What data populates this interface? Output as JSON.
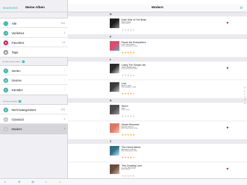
{
  "status": {
    "carrier": "Carrier ᯤ",
    "time": "12:00 PM",
    "battery": "100%"
  },
  "sidebar": {
    "edit_label": "Bearbeiten",
    "title": "Meine Alben",
    "library": [
      {
        "label": "Alle",
        "count": "540",
        "icon": "music-icon",
        "color": "#3fb9b0",
        "glyph": "♪"
      },
      {
        "label": "Verliehen",
        "count": "3",
        "icon": "lend-icon",
        "color": "#3fb9b0",
        "glyph": "↗"
      },
      {
        "label": "Favoriten",
        "count": "15",
        "icon": "heart-icon",
        "color": "#e0245e",
        "glyph": "♥"
      },
      {
        "label": "Tags",
        "count": "",
        "icon": "tag-icon",
        "color": "#9a9aa0",
        "glyph": "◆"
      }
    ],
    "browse_header": "DURCHSUCHEN",
    "browse": [
      {
        "label": "Serien",
        "count": "›",
        "icon": "series-icon",
        "color": "#3fb9b0",
        "glyph": "≡"
      },
      {
        "label": "Genres",
        "count": "›",
        "icon": "genre-icon",
        "color": "#3fb9b0",
        "glyph": "◎"
      },
      {
        "label": "Künstler",
        "count": "›",
        "icon": "artist-icon",
        "color": "#3fb9b0",
        "glyph": "☺"
      }
    ],
    "categories_header": "KATEGORIEN",
    "categories": [
      {
        "label": "Nicht kategorisiert",
        "count": "532",
        "icon": "uncategorized-icon",
        "color": "#3fb9b0",
        "glyph": "∅"
      },
      {
        "label": "Classical",
        "count": "2",
        "icon": "classical-icon",
        "color": "#c6c6ca",
        "glyph": "●"
      },
      {
        "label": "Modern",
        "count": "6",
        "icon": "modern-icon",
        "color": "#c6c6ca",
        "glyph": "●"
      }
    ],
    "tabbar": [
      "≡",
      "⚙",
      "⊞",
      "⌕",
      "✓"
    ]
  },
  "main": {
    "title": "Modern",
    "sections": [
      {
        "letter": "D",
        "albums": [
          {
            "title": "Dark Side of The Brain",
            "artist": "Peter King",
            "meta": "Pop, 2015",
            "rating": 0,
            "favorite": true,
            "cover": [
              "#1c1c1c",
              "#8c8c8c"
            ]
          }
        ]
      },
      {
        "letter": "F",
        "albums": [
          {
            "title": "Faces the Everywhere",
            "artist": "The Third Man",
            "meta": "Pop, Elevation, 2013",
            "rating": 5,
            "favorite": false,
            "cover": [
              "#e8456b",
              "#3fb9b0"
            ]
          }
        ]
      },
      {
        "letter": "L",
        "albums": [
          {
            "title": "Living The Simple Life",
            "artist": "Clark Wellington",
            "meta": "Pop, Elevation, 2014",
            "rating": 0,
            "favorite": true,
            "cover": [
              "#2a2a2a",
              "#d8d8d8"
            ]
          },
          {
            "title": "Lost",
            "artist": "Bruno Carr",
            "meta": "Pop, Elation, 2016",
            "rating": 4,
            "favorite": false,
            "cover": [
              "#3a3a3a",
              "#bdbdbd"
            ]
          }
        ]
      },
      {
        "letter": "S",
        "albums": [
          {
            "title": "Storm",
            "artist": "Kyle",
            "meta": "Pop, 2015",
            "rating": 0,
            "favorite": false,
            "cover": [
              "#4a4a4a",
              "#9a9a9a"
            ]
          },
          {
            "title": "Sweet Elements",
            "artist": "Dannii Sunns",
            "meta": "Pop, Germany, 2012",
            "rating": 5,
            "favorite": true,
            "cover": [
              "#e0735f",
              "#f2c6b8"
            ]
          }
        ]
      },
      {
        "letter": "T",
        "albums": [
          {
            "title": "The Debut Album",
            "artist": "Benjamin Harris",
            "meta": "Pop, Elevation, 2011",
            "rating": 4,
            "favorite": false,
            "cover": [
              "#2b6f8a",
              "#cfe2ea"
            ]
          },
          {
            "title": "This Growing Love",
            "artist": "Louise Brandon",
            "meta": "Pop, 2013",
            "rating": 0,
            "favorite": true,
            "cover": [
              "#6a4a3a",
              "#d1b6a2"
            ]
          }
        ]
      }
    ],
    "index": [
      "D",
      "F",
      "L",
      "S",
      "T",
      "#"
    ]
  }
}
